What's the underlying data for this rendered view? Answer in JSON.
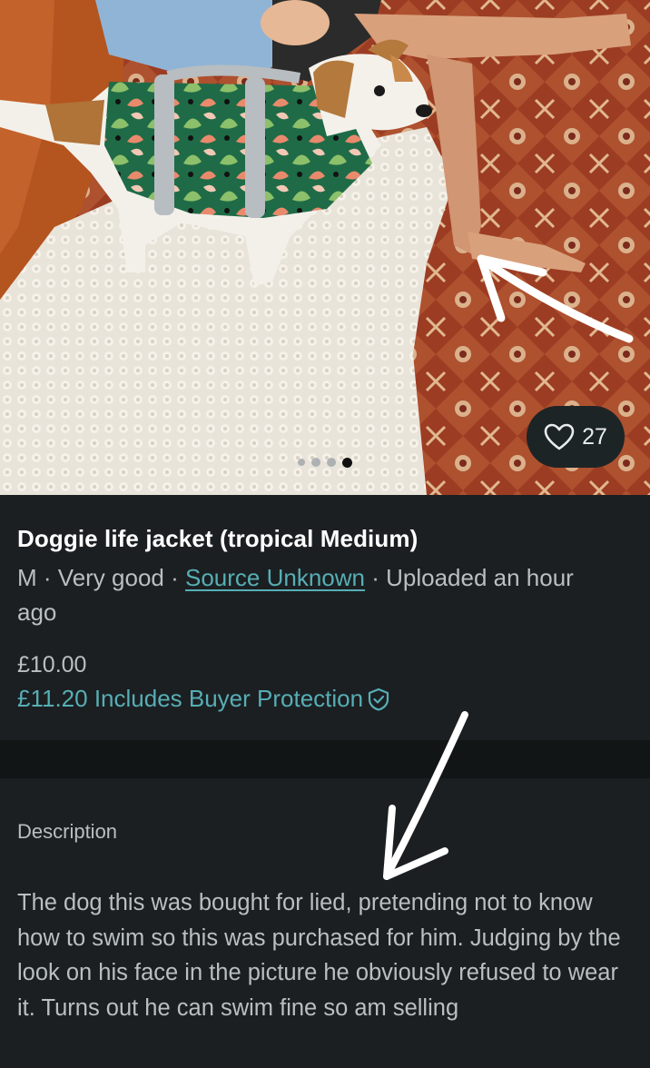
{
  "listing": {
    "title": "Doggie life jacket (tropical Medium)",
    "meta": {
      "size": "M",
      "separator": " · ",
      "condition": "Very good",
      "brand": "Source Unknown",
      "uploaded": "Uploaded an hour ago"
    },
    "price": "£10.00",
    "price_with_protection": "£11.20 Includes Buyer Protection",
    "likes": "27"
  },
  "gallery": {
    "total_images": 4,
    "active_index": 3
  },
  "description": {
    "heading": "Description",
    "text": "The dog this was bought for lied, pretending not to know how to swim so this was purchased for him. Judging by the look on his face in the picture he obviously refused to wear it. Turns out he can swim fine so am selling"
  },
  "colors": {
    "background": "#1b1f21",
    "accent": "#57aeb5",
    "muted_text": "#b9bfc3"
  }
}
